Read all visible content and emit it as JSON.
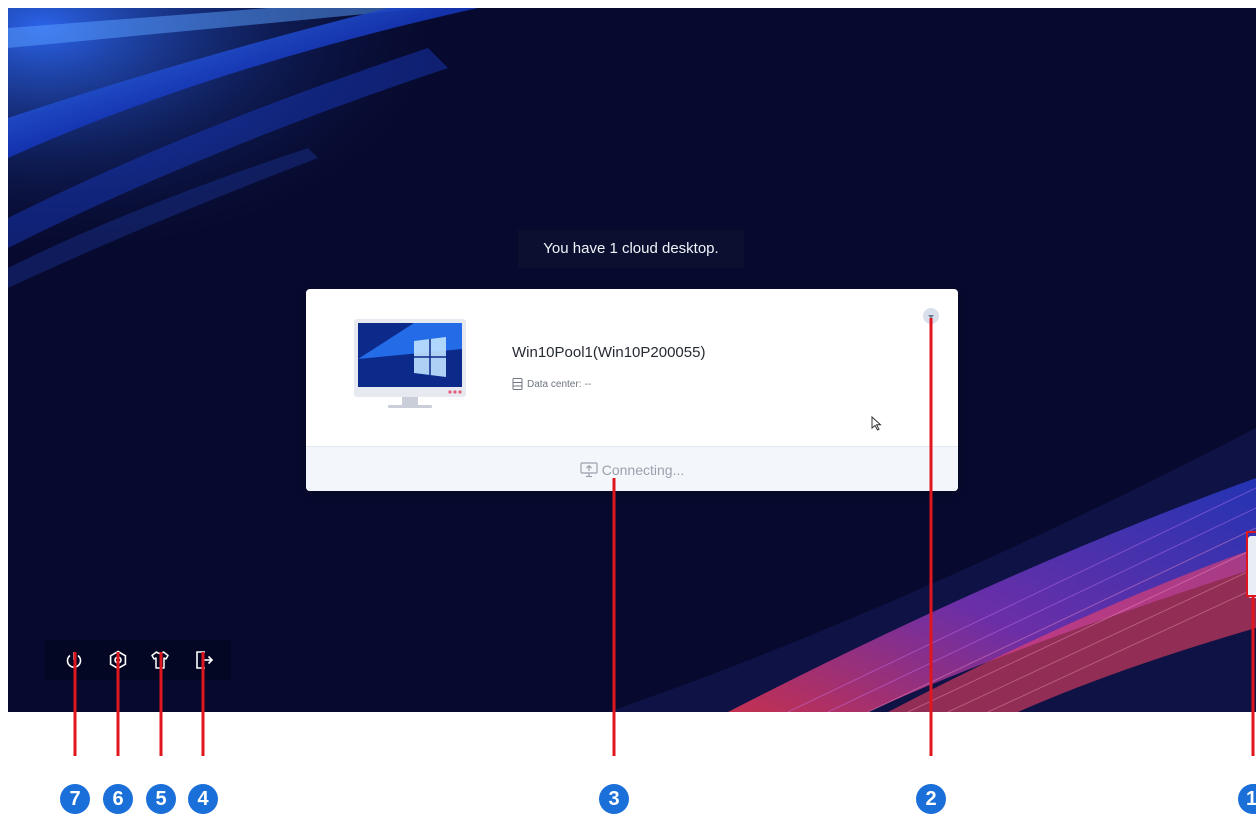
{
  "banner": {
    "text": "You have 1 cloud desktop."
  },
  "desktop_card": {
    "name": "Win10Pool1(Win10P200055)",
    "data_center_label": "Data center:",
    "data_center_value": "--",
    "status_text": "Connecting...",
    "thumbnail_icon": "monitor-windows-wallpaper",
    "menu_icon": "chevron-down-icon",
    "status_icon": "monitor-upload-icon"
  },
  "toolbar": {
    "items": [
      {
        "icon": "power-icon"
      },
      {
        "icon": "settings-icon"
      },
      {
        "icon": "theme-shirt-icon"
      },
      {
        "icon": "logout-icon"
      }
    ]
  },
  "callouts": [
    "7",
    "6",
    "5",
    "4",
    "3",
    "2",
    "1"
  ],
  "colors": {
    "callout_line": "#e0161e",
    "callout_marker": "#1a6fd8",
    "background": "#070a2e",
    "card": "#ffffff"
  }
}
